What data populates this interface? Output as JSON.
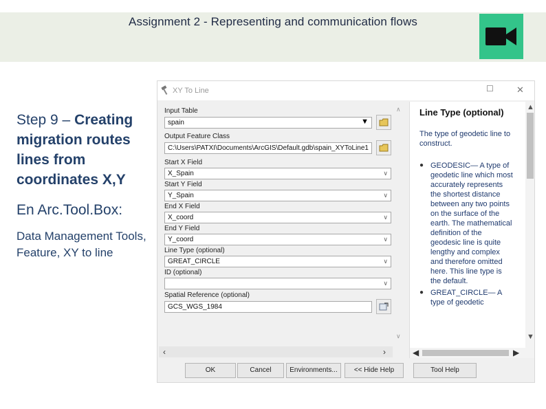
{
  "slide": {
    "title": "Assignment 2 - Representing and communication flows",
    "video_icon": "video-camera-icon",
    "accent_color": "#33c48a",
    "banner_color": "#ebefe6"
  },
  "left": {
    "step_prefix": "Step 9 – ",
    "step_bold": "Creating migration routes lines from coordinates X,Y",
    "toolbox": "En Arc.Tool.Box:",
    "path": "Data Management Tools, Feature, XY to line"
  },
  "dialog": {
    "title": "XY To Line",
    "fields": {
      "input_table": {
        "label": "Input Table",
        "value": "spain"
      },
      "output_feature_class": {
        "label": "Output Feature Class",
        "value": "C:\\Users\\PATXI\\Documents\\ArcGIS\\Default.gdb\\spain_XYToLine1"
      },
      "start_x": {
        "label": "Start X Field",
        "value": "X_Spain"
      },
      "start_y": {
        "label": "Start Y Field",
        "value": "Y_Spain"
      },
      "end_x": {
        "label": "End X Field",
        "value": "X_coord"
      },
      "end_y": {
        "label": "End Y Field",
        "value": "Y_coord"
      },
      "line_type": {
        "label": "Line Type (optional)",
        "value": "GREAT_CIRCLE"
      },
      "id": {
        "label": "ID (optional)",
        "value": ""
      },
      "spatial_reference": {
        "label": "Spatial Reference (optional)",
        "value": "GCS_WGS_1984"
      }
    },
    "help": {
      "title": "Line Type (optional)",
      "description": "The type of geodetic line to construct.",
      "items": [
        "GEODESIC— A type of geodetic line which most accurately represents the shortest distance between any two points on the surface of the earth. The mathematical definition of the geodesic line is quite lengthy and complex and therefore omitted here. This line type is the default.",
        "GREAT_CIRCLE— A type of geodetic"
      ]
    },
    "buttons": {
      "ok": "OK",
      "cancel": "Cancel",
      "environments": "Environments...",
      "hide_help": "<< Hide Help",
      "tool_help": "Tool Help"
    }
  }
}
